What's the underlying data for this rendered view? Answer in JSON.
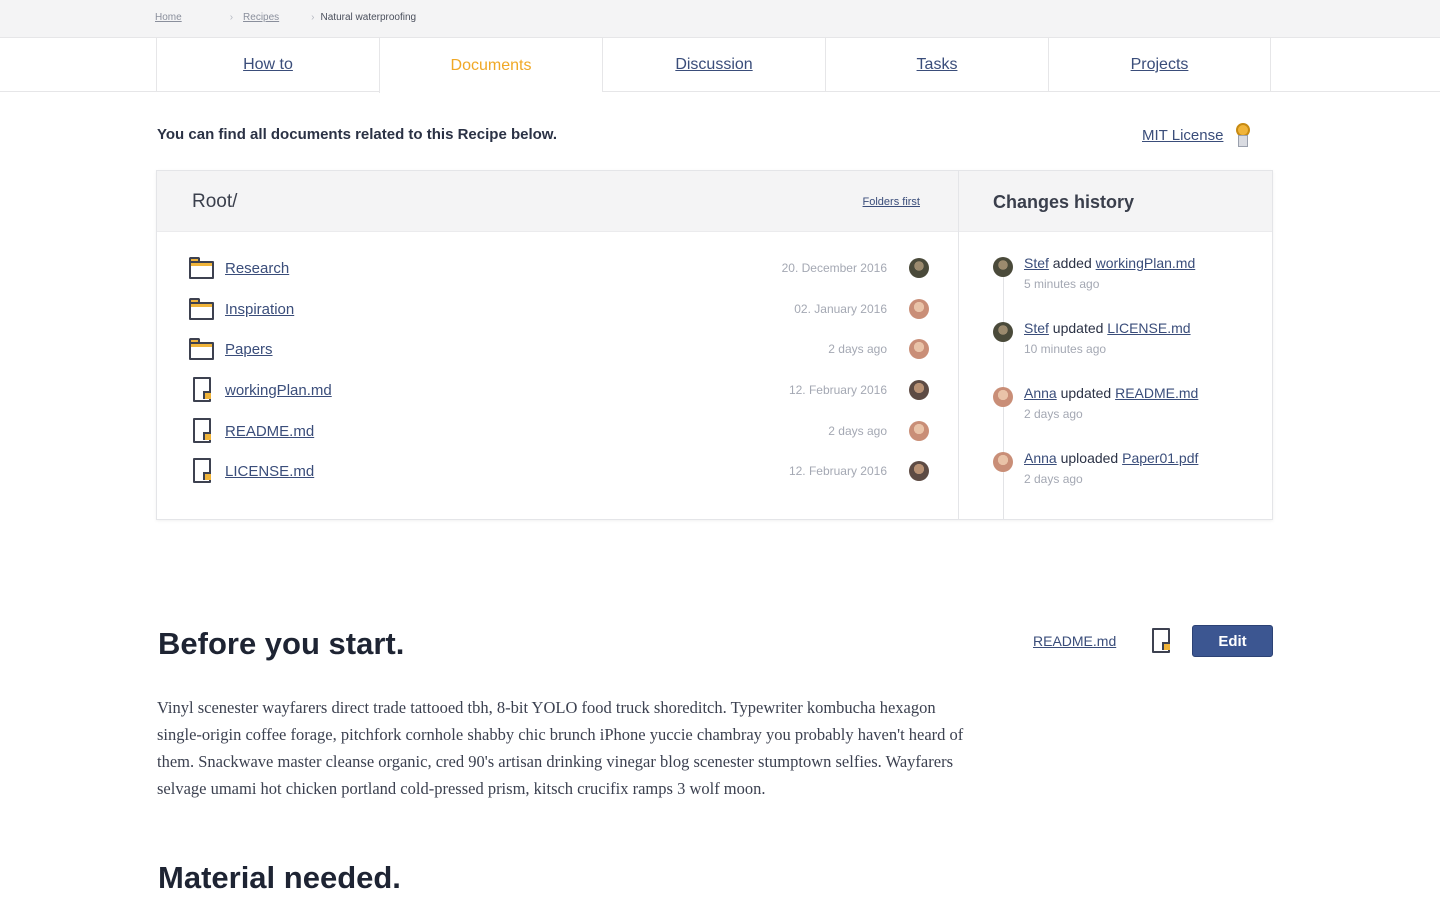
{
  "breadcrumb": {
    "home": "Home",
    "section": "Recipes",
    "current": "Natural waterproofing"
  },
  "tabs": [
    {
      "label": "How to",
      "active": false
    },
    {
      "label": "Documents",
      "active": true
    },
    {
      "label": "Discussion",
      "active": false
    },
    {
      "label": "Tasks",
      "active": false
    },
    {
      "label": "Projects",
      "active": false
    }
  ],
  "intro": "You can find all documents related to this Recipe below.",
  "license": {
    "label": "MIT License",
    "icon": "badge-icon"
  },
  "files": {
    "path": "Root/",
    "sort_label": "Folders first",
    "items": [
      {
        "name": "Research",
        "type": "folder",
        "date": "20. December 2016",
        "avatar": "dark"
      },
      {
        "name": "Inspiration",
        "type": "folder",
        "date": "02. January 2016",
        "avatar": "light"
      },
      {
        "name": "Papers",
        "type": "folder",
        "date": "2 days ago",
        "avatar": "light"
      },
      {
        "name": "workingPlan.md",
        "type": "file",
        "date": "12. February 2016",
        "avatar": "mid"
      },
      {
        "name": "README.md",
        "type": "file",
        "date": "2 days ago",
        "avatar": "light"
      },
      {
        "name": "LICENSE.md",
        "type": "file",
        "date": "12. February 2016",
        "avatar": "mid"
      }
    ]
  },
  "history": {
    "title": "Changes history",
    "items": [
      {
        "user": "Stef",
        "action": "added",
        "file": "workingPlan.md",
        "when": "5 minutes ago",
        "avatar": "dark"
      },
      {
        "user": "Stef",
        "action": "updated",
        "file": "LICENSE.md",
        "when": "10 minutes ago",
        "avatar": "dark"
      },
      {
        "user": "Anna",
        "action": "updated",
        "file": "README.md",
        "when": "2 days ago",
        "avatar": "light"
      },
      {
        "user": "Anna",
        "action": "uploaded",
        "file": "Paper01.pdf",
        "when": "2 days ago",
        "avatar": "light"
      }
    ]
  },
  "content": {
    "before_title": "Before you start.",
    "readme_label": "README.md",
    "edit_label": "Edit",
    "paragraph": "Vinyl scenester wayfarers direct trade tattooed tbh, 8-bit YOLO food truck shoreditch. Typewriter kombucha hexagon single-origin coffee forage, pitchfork cornhole shabby chic brunch iPhone yuccie chambray you probably haven't heard of them. Snackwave master cleanse organic, cred 90's artisan drinking vinegar blog scenester stumptown selfies. Wayfarers selvage umami hot chicken portland cold-pressed prism, kitsch crucifix ramps 3 wolf moon.",
    "material_title": "Material needed."
  },
  "colors": {
    "accent": "#f0a826",
    "link": "#3a4d7a",
    "button": "#3c5691"
  }
}
